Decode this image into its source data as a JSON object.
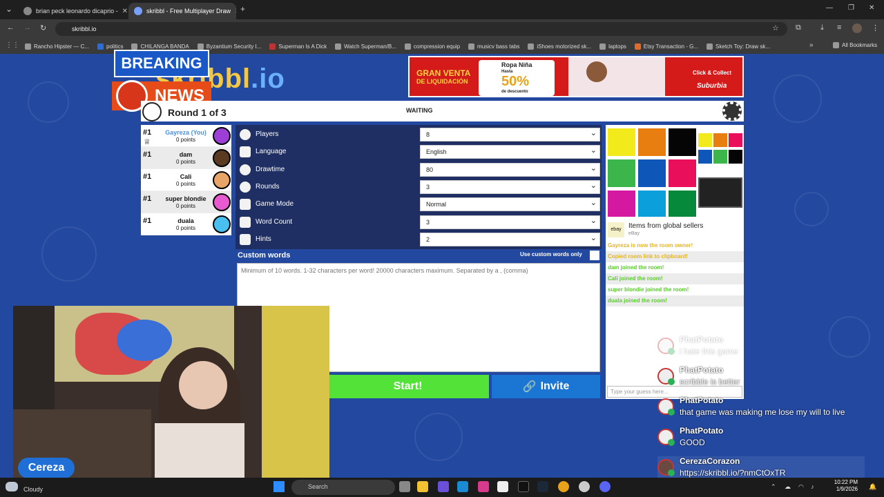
{
  "browser": {
    "tabs": [
      {
        "label": "brian peck leonardo dicaprio -",
        "active": false
      },
      {
        "label": "skribbl - Free Multiplayer Draw",
        "active": true
      }
    ],
    "url": "skribbl.io",
    "bookmarks": [
      "Rancho Hipster — C...",
      "politics",
      "CHILANGA BANDA",
      "Byzantium Security I...",
      "Superman Is A Dick",
      "Watch Superman/B...",
      "compression equip",
      "musicv bass tabs",
      "iShoes motorized sk...",
      "laptops",
      "Etsy Transaction - G...",
      "Sketch Toy: Draw sk..."
    ],
    "all_bookmarks": "All Bookmarks"
  },
  "overlay": {
    "breaking": "BREAKING",
    "news": "NEWS",
    "streamer_name": "Cereza"
  },
  "logo": {
    "text_a": "skribbl",
    "text_b": ".io"
  },
  "ad": {
    "headline1": "GRAN VENTA",
    "headline2": "DE LIQUIDACIÓN",
    "product": "Ropa Niña",
    "upto": "Hasta",
    "discount": "50%",
    "discount_sub": "de descuento",
    "cta": "Click & Collect",
    "brand": "Suburbia"
  },
  "game": {
    "round": "Round 1 of 3",
    "status": "WAITING",
    "players": [
      {
        "rank": "#1",
        "name": "Gayreza (You)",
        "points": "0 points",
        "color": "#9b3fd6",
        "you": true
      },
      {
        "rank": "#1",
        "name": "dam",
        "points": "0 points",
        "color": "#5b3a22",
        "you": false
      },
      {
        "rank": "#1",
        "name": "Cali",
        "points": "0 points",
        "color": "#e8a56a",
        "you": false
      },
      {
        "rank": "#1",
        "name": "super blondie",
        "points": "0 points",
        "color": "#e85ad0",
        "you": false
      },
      {
        "rank": "#1",
        "name": "duala",
        "points": "0 points",
        "color": "#4ac0f0",
        "you": false
      }
    ],
    "settings": [
      {
        "label": "Players",
        "value": "8"
      },
      {
        "label": "Language",
        "value": "English"
      },
      {
        "label": "Drawtime",
        "value": "80"
      },
      {
        "label": "Rounds",
        "value": "3"
      },
      {
        "label": "Game Mode",
        "value": "Normal"
      },
      {
        "label": "Word Count",
        "value": "3"
      },
      {
        "label": "Hints",
        "value": "2"
      }
    ],
    "custom_words_label": "Custom words",
    "use_custom_label": "Use custom words only",
    "custom_placeholder": "Minimum of 10 words. 1-32 characters per word! 20000 characters maximum. Separated by a , (comma)",
    "start_label": "Start!",
    "invite_label": "Invite"
  },
  "side_ad": {
    "title": "Items from global sellers",
    "source": "eBay",
    "logo": "ebay"
  },
  "chat": {
    "messages": [
      {
        "text": "Gayreza is now the room owner!",
        "kind": "gold"
      },
      {
        "text": "Copied room link to clipboard!",
        "kind": "gold"
      },
      {
        "text": "dam joined the room!",
        "kind": "green"
      },
      {
        "text": "Cali joined the room!",
        "kind": "green"
      },
      {
        "text": "super blondie joined the room!",
        "kind": "green"
      },
      {
        "text": "duala joined the room!",
        "kind": "green"
      }
    ],
    "input_placeholder": "Type your guess here..."
  },
  "stream_chat": [
    {
      "name": "PhatPotato",
      "text": "i hate this game",
      "faded": true
    },
    {
      "name": "PhatPotato",
      "text": "scribble is better",
      "faded": false
    },
    {
      "name": "PhatPotato",
      "text": "that game was making me lose my will to live",
      "faded": false
    },
    {
      "name": "PhatPotato",
      "text": "GOOD",
      "faded": false
    },
    {
      "name": "CerezaCorazon",
      "text": "https://skribbl.io/?nmCtOxTR",
      "faded": false
    }
  ],
  "taskbar": {
    "weather": "Cloudy",
    "search": "Search",
    "time": "10:22 PM",
    "date": "1/9/2026"
  }
}
